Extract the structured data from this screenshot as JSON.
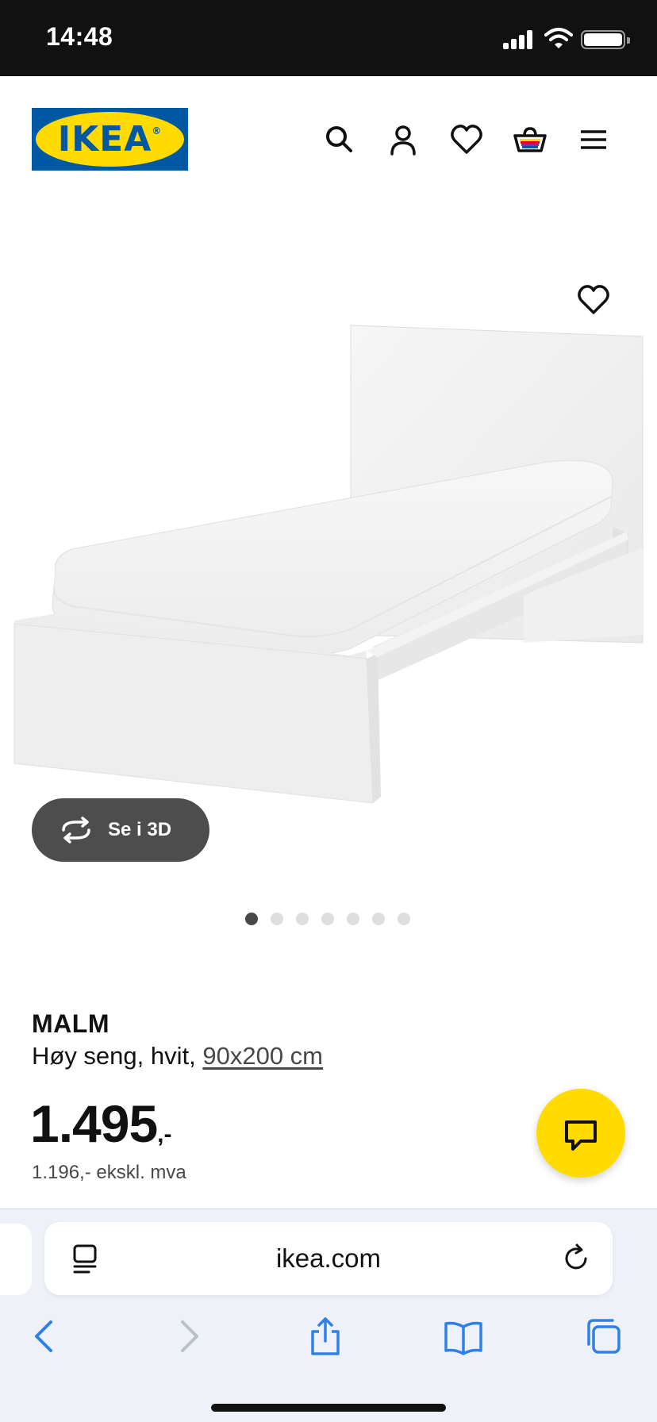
{
  "status_bar": {
    "time": "14:48",
    "icons": [
      "cellular-signal-icon",
      "wifi-icon",
      "battery-icon"
    ]
  },
  "header": {
    "logo_text": "IKEA",
    "icons": [
      "search-icon",
      "account-icon",
      "heart-icon",
      "shopping-bag-icon",
      "menu-icon"
    ]
  },
  "gallery": {
    "view_3d_label": "Se i 3D",
    "image_count": 7,
    "active_index": 0
  },
  "product": {
    "name": "MALM",
    "description": "Høy seng, hvit, ",
    "size": "90x200 cm",
    "price": "1.495",
    "price_suffix": ",-",
    "price_ex_vat": "1.196,- ekskl. mva"
  },
  "browser": {
    "address": "ikea.com",
    "toolbar": [
      "back-icon",
      "forward-icon",
      "share-icon",
      "bookmarks-icon",
      "tabs-icon"
    ]
  },
  "colors": {
    "ikea_blue": "#0058a3",
    "ikea_yellow": "#ffdb00",
    "safari_blue": "#2f80e8",
    "text": "#111111"
  }
}
